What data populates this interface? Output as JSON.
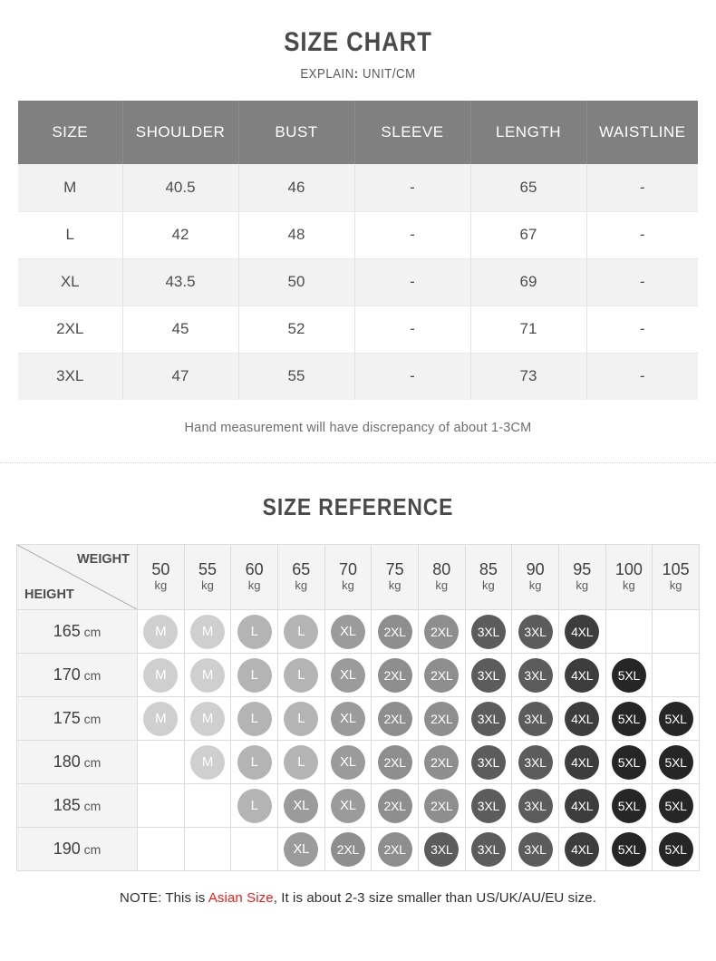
{
  "size_chart": {
    "title": "SIZE CHART",
    "subtitle_prefix": "EXPLAIN",
    "subtitle_colon": ":",
    "subtitle_value": "UNIT/CM",
    "columns": [
      "SIZE",
      "SHOULDER",
      "BUST",
      "SLEEVE",
      "LENGTH",
      "WAISTLINE"
    ],
    "rows": [
      {
        "size": "M",
        "shoulder": "40.5",
        "bust": "46",
        "sleeve": "-",
        "length": "65",
        "waistline": "-"
      },
      {
        "size": "L",
        "shoulder": "42",
        "bust": "48",
        "sleeve": "-",
        "length": "67",
        "waistline": "-"
      },
      {
        "size": "XL",
        "shoulder": "43.5",
        "bust": "50",
        "sleeve": "-",
        "length": "69",
        "waistline": "-"
      },
      {
        "size": "2XL",
        "shoulder": "45",
        "bust": "52",
        "sleeve": "-",
        "length": "71",
        "waistline": "-"
      },
      {
        "size": "3XL",
        "shoulder": "47",
        "bust": "55",
        "sleeve": "-",
        "length": "73",
        "waistline": "-"
      }
    ],
    "hand_note": "Hand measurement will have discrepancy of about 1-3CM"
  },
  "size_reference": {
    "title": "SIZE REFERENCE",
    "weight_label": "WEIGHT",
    "height_label": "HEIGHT",
    "weight_unit": "kg",
    "height_unit": "cm",
    "weights": [
      "50",
      "55",
      "60",
      "65",
      "70",
      "75",
      "80",
      "85",
      "90",
      "95",
      "100",
      "105"
    ],
    "heights": [
      "165",
      "170",
      "175",
      "180",
      "185",
      "190"
    ],
    "grid": [
      [
        "M",
        "M",
        "L",
        "L",
        "XL",
        "2XL",
        "2XL",
        "3XL",
        "3XL",
        "4XL",
        "",
        ""
      ],
      [
        "M",
        "M",
        "L",
        "L",
        "XL",
        "2XL",
        "2XL",
        "3XL",
        "3XL",
        "4XL",
        "5XL",
        ""
      ],
      [
        "M",
        "M",
        "L",
        "L",
        "XL",
        "2XL",
        "2XL",
        "3XL",
        "3XL",
        "4XL",
        "5XL",
        "5XL"
      ],
      [
        "",
        "M",
        "L",
        "L",
        "XL",
        "2XL",
        "2XL",
        "3XL",
        "3XL",
        "4XL",
        "5XL",
        "5XL"
      ],
      [
        "",
        "",
        "L",
        "XL",
        "XL",
        "2XL",
        "2XL",
        "3XL",
        "3XL",
        "4XL",
        "5XL",
        "5XL"
      ],
      [
        "",
        "",
        "",
        "XL",
        "2XL",
        "2XL",
        "3XL",
        "3XL",
        "3XL",
        "4XL",
        "5XL",
        "5XL"
      ]
    ],
    "bubble_colors": {
      "M": "#cfcfcf",
      "L": "#b4b4b4",
      "XL": "#9b9b9b",
      "2XL": "#8e8e8e",
      "3XL": "#5c5c5c",
      "4XL": "#3d3d3d",
      "5XL": "#262626"
    }
  },
  "footer": {
    "note_prefix": "NOTE: This is ",
    "note_highlight": "Asian Size",
    "note_suffix": ", It is about 2-3 size smaller than US/UK/AU/EU size.",
    "highlight_color": "#ee1c1c"
  }
}
